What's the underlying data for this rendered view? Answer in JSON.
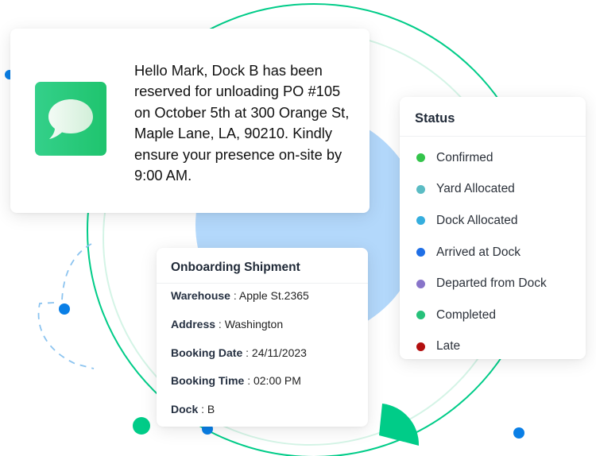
{
  "colors": {
    "accent_green": "#00cc88",
    "accent_blue": "#0a7fe6",
    "light_blue_blob": "#b3d8fb",
    "dashed_blue": "#8cc4f0"
  },
  "message": {
    "icon": "chat-bubble-icon",
    "text": "Hello Mark, Dock B has been reserved for unloading PO #105 on October 5th at 300 Orange St, Maple Lane, LA, 90210. Kindly ensure your presence on-site by 9:00 AM."
  },
  "status": {
    "title": "Status",
    "items": [
      {
        "label": "Confirmed",
        "color": "#34c44b"
      },
      {
        "label": "Yard Allocated",
        "color": "#5bbcc4"
      },
      {
        "label": "Dock Allocated",
        "color": "#35aede"
      },
      {
        "label": "Arrived at Dock",
        "color": "#1f6fe6"
      },
      {
        "label": "Departed from Dock",
        "color": "#8874c9"
      },
      {
        "label": "Completed",
        "color": "#27c17a"
      },
      {
        "label": "Late",
        "color": "#b30f0f"
      }
    ]
  },
  "shipment": {
    "title": "Onboarding Shipment",
    "separator": ":",
    "rows": [
      {
        "label": "Warehouse",
        "value": "Apple St.2365"
      },
      {
        "label": "Address",
        "value": "Washington"
      },
      {
        "label": "Booking Date",
        "value": "24/11/2023"
      },
      {
        "label": "Booking Time",
        "value": "02:00 PM"
      },
      {
        "label": "Dock",
        "value": "B"
      }
    ]
  }
}
